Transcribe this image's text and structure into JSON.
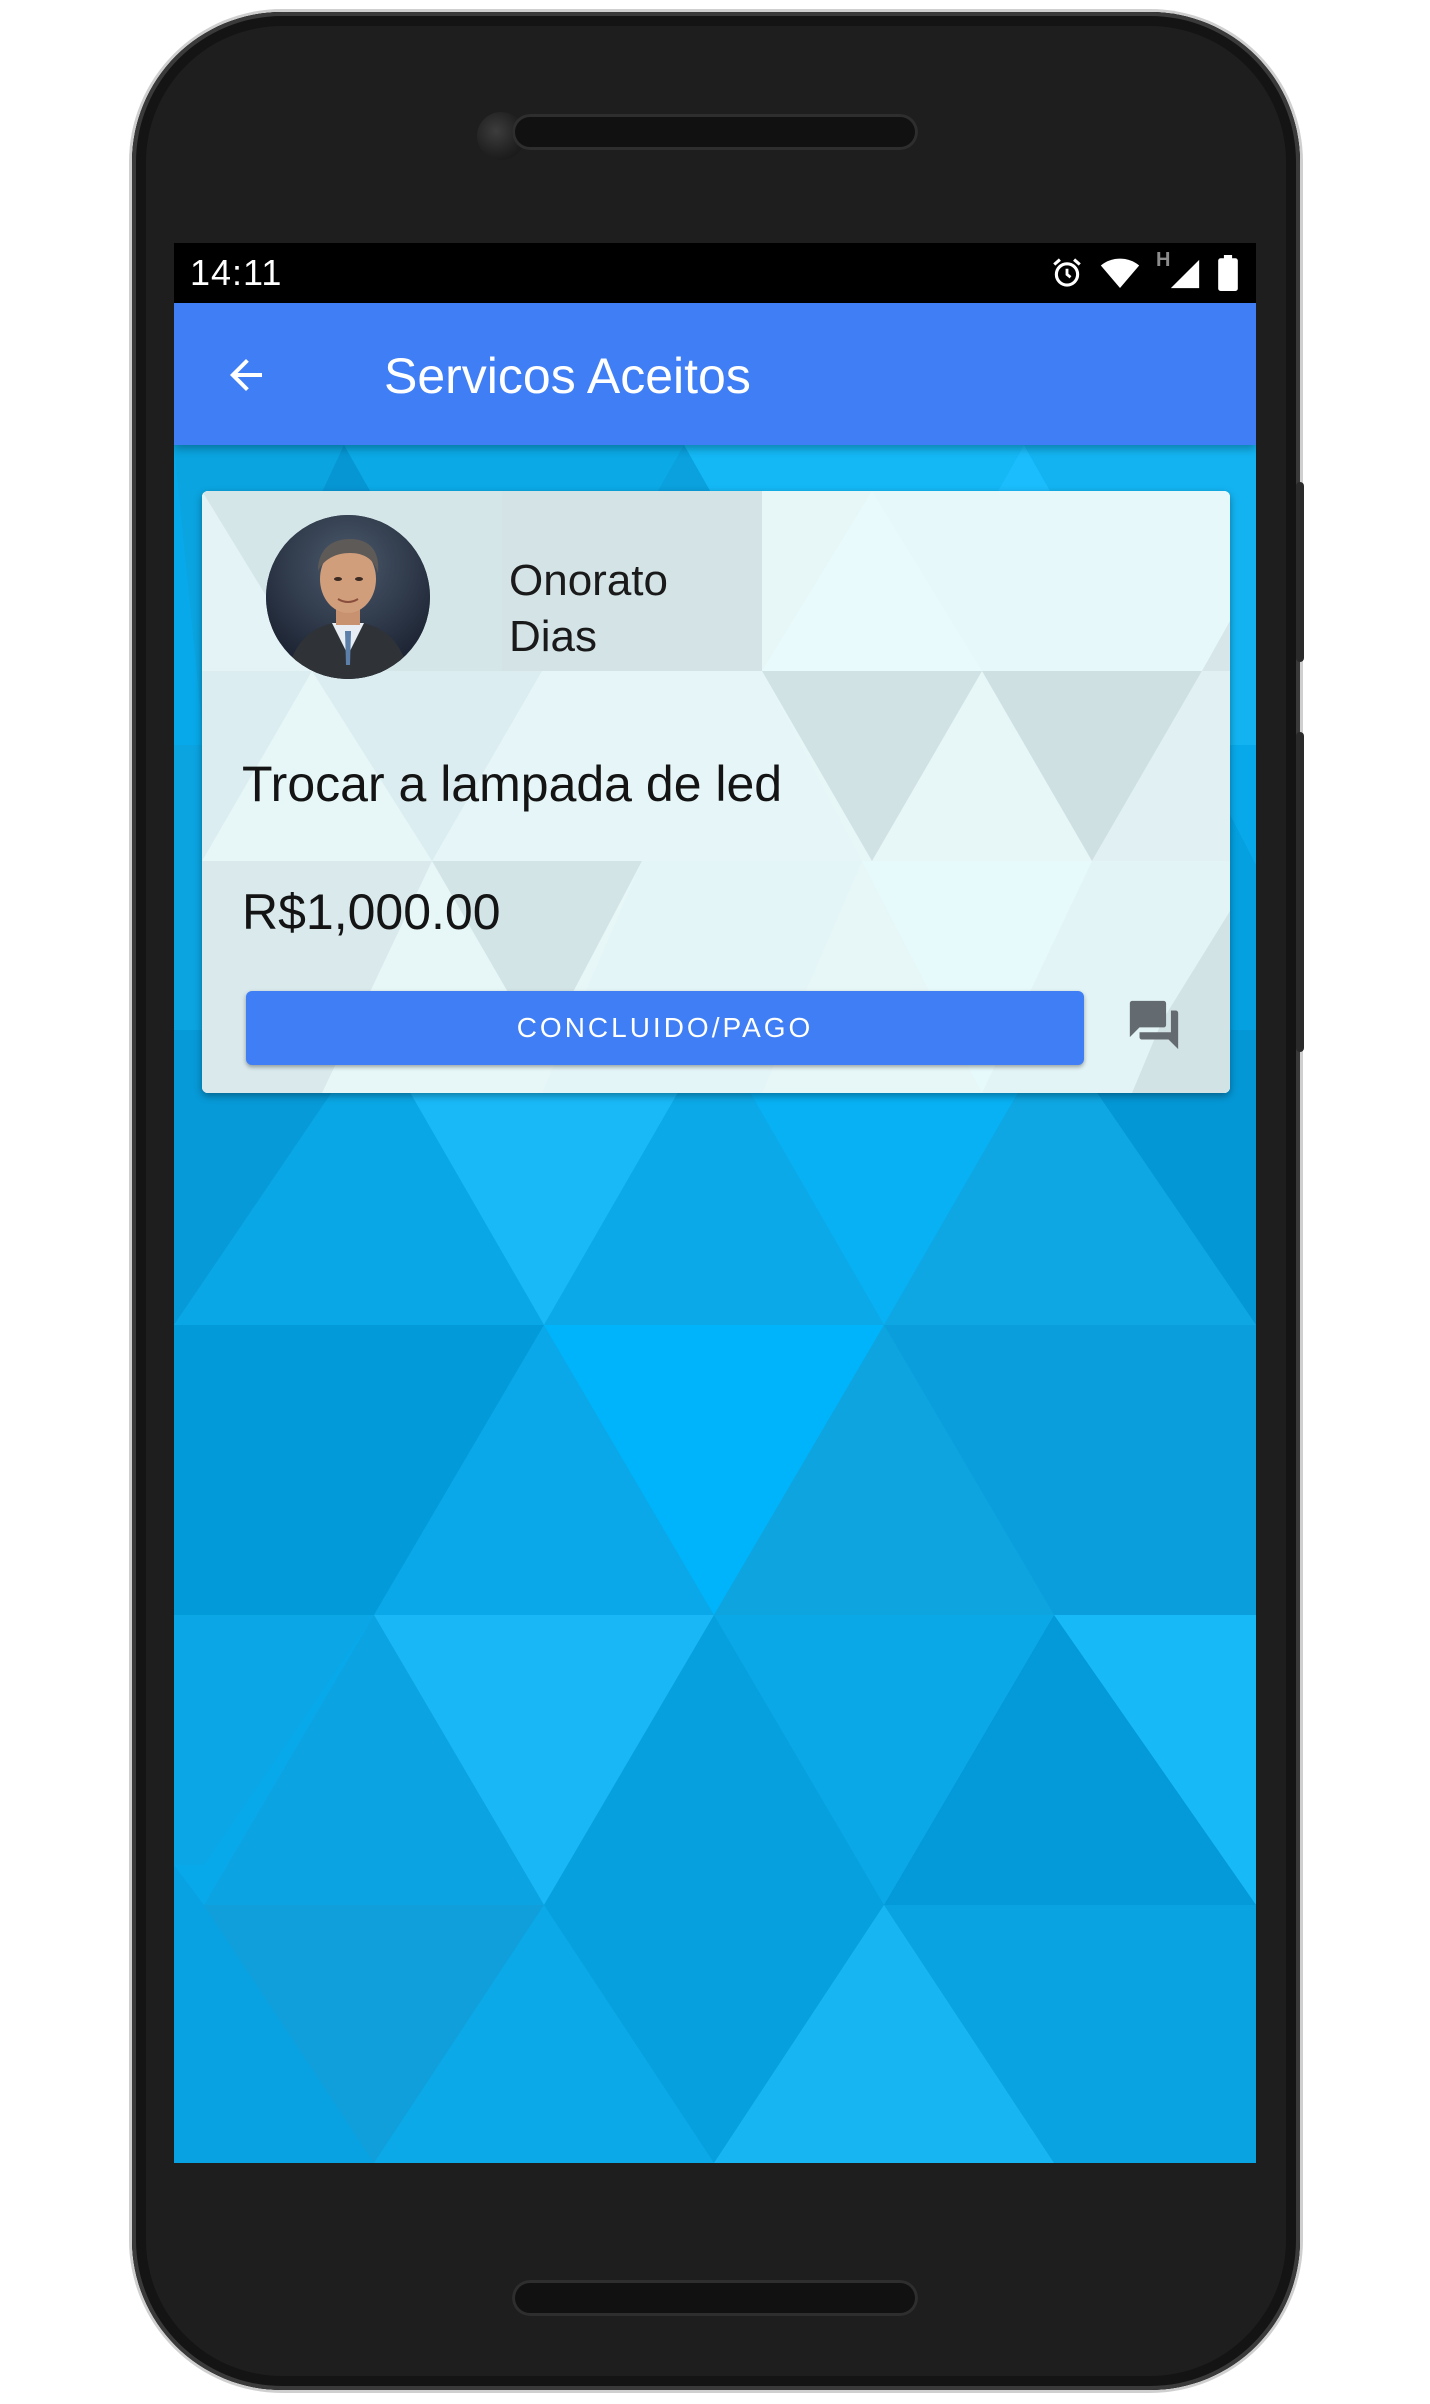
{
  "status_bar": {
    "time": "14:11",
    "network_label": "H",
    "icons": [
      "alarm-icon",
      "wifi-icon",
      "cell-signal-icon",
      "battery-icon"
    ]
  },
  "app_bar": {
    "title": "Servicos Aceitos",
    "back_icon": "arrow-back-icon",
    "color": "#3f7ef5"
  },
  "service_card": {
    "provider_name": "Onorato\nDias",
    "description": "Trocar a lampada de led",
    "price": "R$1,000.00",
    "action_label": "CONCLUIDO/PAGO",
    "action_color": "#3f7ef5",
    "chat_icon": "chat-icon",
    "avatar_icon": "avatar-photo"
  },
  "background_color": "#08a9ea"
}
